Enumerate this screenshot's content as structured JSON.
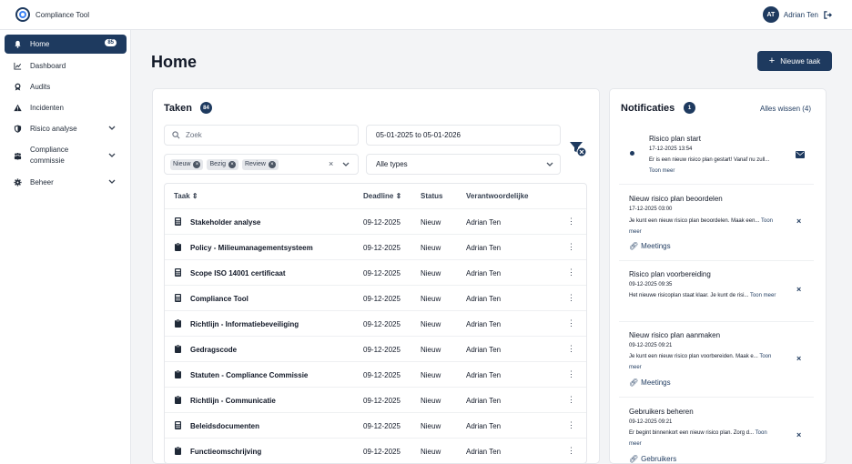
{
  "app": {
    "title": "Compliance Tool"
  },
  "user": {
    "initials": "AT",
    "name": "Adrian Ten"
  },
  "sidebar": {
    "items": [
      {
        "label": "Home",
        "icon": "bell-icon",
        "badge": "85",
        "active": true
      },
      {
        "label": "Dashboard",
        "icon": "chart-icon"
      },
      {
        "label": "Audits",
        "icon": "award-icon"
      },
      {
        "label": "Incidenten",
        "icon": "warning-icon"
      },
      {
        "label": "Risico analyse",
        "icon": "shield-icon",
        "expandable": true
      },
      {
        "label": "Compliance commissie",
        "icon": "people-icon",
        "expandable": true
      },
      {
        "label": "Beheer",
        "icon": "gear-icon",
        "expandable": true
      }
    ]
  },
  "page": {
    "title": "Home",
    "new_task_label": "Nieuwe taak"
  },
  "tasks": {
    "title": "Taken",
    "count": "84",
    "search_placeholder": "Zoek",
    "date_range": "05-01-2025 to 05-01-2026",
    "status_chips": [
      "Nieuw",
      "Bezig",
      "Review"
    ],
    "type_select": "Alle types",
    "columns": {
      "name": "Taak",
      "deadline": "Deadline",
      "status": "Status",
      "owner": "Verantwoordelijke"
    },
    "rows": [
      {
        "name": "Stakeholder analyse",
        "deadline": "09-12-2025",
        "status": "Nieuw",
        "owner": "Adrian Ten",
        "icon": "calculator-icon"
      },
      {
        "name": "Policy - Milieumanagementsysteem",
        "deadline": "09-12-2025",
        "status": "Nieuw",
        "owner": "Adrian Ten",
        "icon": "clipboard-icon"
      },
      {
        "name": "Scope ISO 14001 certificaat",
        "deadline": "09-12-2025",
        "status": "Nieuw",
        "owner": "Adrian Ten",
        "icon": "calculator-icon"
      },
      {
        "name": "Compliance Tool",
        "deadline": "09-12-2025",
        "status": "Nieuw",
        "owner": "Adrian Ten",
        "icon": "calculator-icon"
      },
      {
        "name": "Richtlijn - Informatiebeveiliging",
        "deadline": "09-12-2025",
        "status": "Nieuw",
        "owner": "Adrian Ten",
        "icon": "clipboard-icon"
      },
      {
        "name": "Gedragscode",
        "deadline": "09-12-2025",
        "status": "Nieuw",
        "owner": "Adrian Ten",
        "icon": "clipboard-icon"
      },
      {
        "name": "Statuten - Compliance Commissie",
        "deadline": "09-12-2025",
        "status": "Nieuw",
        "owner": "Adrian Ten",
        "icon": "clipboard-icon"
      },
      {
        "name": "Richtlijn - Communicatie",
        "deadline": "09-12-2025",
        "status": "Nieuw",
        "owner": "Adrian Ten",
        "icon": "clipboard-icon"
      },
      {
        "name": "Beleidsdocumenten",
        "deadline": "09-12-2025",
        "status": "Nieuw",
        "owner": "Adrian Ten",
        "icon": "calculator-icon"
      },
      {
        "name": "Functieomschrijving",
        "deadline": "09-12-2025",
        "status": "Nieuw",
        "owner": "Adrian Ten",
        "icon": "clipboard-icon"
      }
    ]
  },
  "notifications": {
    "title": "Notificaties",
    "count": "1",
    "clear_all": "Alles wissen (4)",
    "items": [
      {
        "title": "Risico plan start",
        "time": "17-12-2025 13:54",
        "body": "Er is een nieuw risico plan gestart! Vanaf nu zull...",
        "more": "Toon meer",
        "unread": true
      },
      {
        "title": "Nieuw risico plan beoordelen",
        "time": "17-12-2025 03:00",
        "body": "Je kunt een nieuw risico plan beoordelen. Maak een...",
        "more": "Toon meer",
        "link": "Meetings"
      },
      {
        "title": "Risico plan voorbereiding",
        "time": "09-12-2025 09:35",
        "body": "Het nieuwe risicoplan staat klaar. Je kunt de risi...",
        "more": "Toon meer"
      },
      {
        "title": "Nieuw risico plan aanmaken",
        "time": "09-12-2025 09:21",
        "body": "Je kunt een nieuw risico plan voorbereiden. Maak e...",
        "more": "Toon meer",
        "link": "Meetings"
      },
      {
        "title": "Gebruikers beheren",
        "time": "09-12-2025 09:21",
        "body": "Er begint binnenkort een nieuw risico plan. Zorg d...",
        "more": "Toon meer",
        "link": "Gebruikers"
      }
    ]
  },
  "colors": {
    "primary": "#1e3a5f",
    "background": "#f3f4f6"
  }
}
